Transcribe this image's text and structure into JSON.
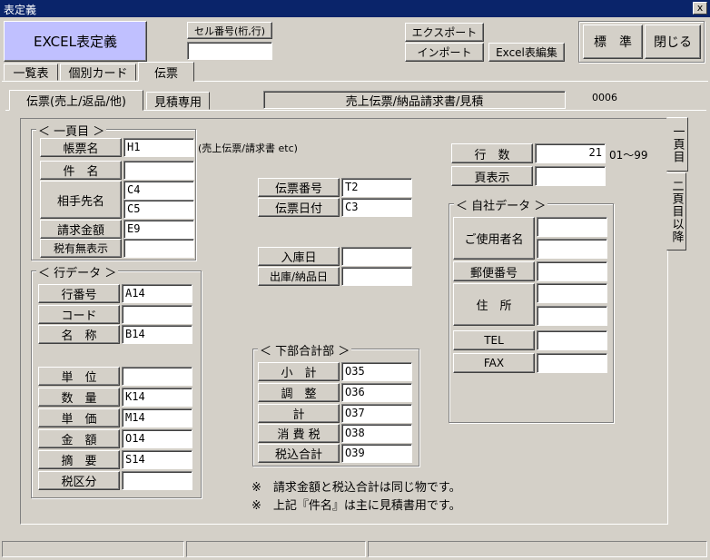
{
  "window": {
    "title": "表定義",
    "close_glyph": "x"
  },
  "toolbar": {
    "excel_def": "EXCEL表定義",
    "cell_no_label": "セル番号(桁,行)",
    "cell_no_value": "",
    "export": "エクスポート",
    "import": "インポート",
    "excel_edit": "Excel表編集",
    "standard": "標　準",
    "close": "閉じる"
  },
  "main_tabs": [
    "一覧表",
    "個別カード",
    "伝票"
  ],
  "sub_tabs": [
    "伝票(売上/返品/他)",
    "見積専用"
  ],
  "header_info": {
    "title": "売上伝票/納品請求書/見積",
    "code": "0006"
  },
  "side_tabs": [
    "一頁目",
    "二頁目以降"
  ],
  "page1": {
    "title": "一頁目",
    "fields": [
      {
        "label": "帳票名",
        "value": "H1"
      },
      {
        "label": "件　名",
        "value": ""
      },
      {
        "label": "相手先名",
        "value": "C4"
      },
      {
        "label": "",
        "value": "C5"
      },
      {
        "label": "請求金額",
        "value": "E9"
      },
      {
        "label": "税有無表示",
        "value": ""
      }
    ],
    "hint": "(売上伝票/請求書 etc)"
  },
  "line_data": {
    "title": "行データ",
    "fields": [
      {
        "label": "行番号",
        "value": "A14"
      },
      {
        "label": "コード",
        "value": ""
      },
      {
        "label": "名　称",
        "value": "B14"
      },
      {
        "label": "単　位",
        "value": ""
      },
      {
        "label": "数　量",
        "value": "K14"
      },
      {
        "label": "単　価",
        "value": "M14"
      },
      {
        "label": "金　額",
        "value": "O14"
      },
      {
        "label": "摘　要",
        "value": "S14"
      },
      {
        "label": "税区分",
        "value": ""
      }
    ]
  },
  "slip": {
    "number_label": "伝票番号",
    "number_value": "T2",
    "date_label": "伝票日付",
    "date_value": "C3",
    "in_label": "入庫日",
    "in_value": "",
    "out_label": "出庫/納品日",
    "out_value": ""
  },
  "totals": {
    "title": "下部合計部",
    "fields": [
      {
        "label": "小　計",
        "value": "O35"
      },
      {
        "label": "調　整",
        "value": "O36"
      },
      {
        "label": "計",
        "value": "O37"
      },
      {
        "label": "消 費 税",
        "value": "O38"
      },
      {
        "label": "税込合計",
        "value": "O39"
      }
    ]
  },
  "rows": {
    "label": "行　数",
    "value": "21",
    "range": "01～99",
    "page_label": "頁表示",
    "page_value": ""
  },
  "company": {
    "title": "自社データ",
    "user_label": "ご使用者名",
    "zip_label": "郵便番号",
    "addr_label": "住　所",
    "tel_label": "TEL",
    "fax_label": "FAX"
  },
  "notes": [
    "※　請求金額と税込合計は同じ物です。",
    "※　上記『件名』は主に見積書用です。"
  ]
}
